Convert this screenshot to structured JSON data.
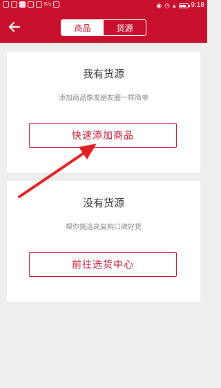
{
  "status_bar": {
    "carrier_text": "K/s",
    "time": "9:18",
    "icons": [
      "notification-icon",
      "notification-icon",
      "eye-icon",
      "alarm-icon",
      "signal-icon",
      "battery-icon"
    ]
  },
  "header": {
    "back_icon": "arrow-left-icon",
    "tabs": [
      {
        "label": "商品",
        "active": true
      },
      {
        "label": "货源",
        "active": false
      }
    ]
  },
  "cards": [
    {
      "title": "我有货源",
      "subtitle": "添加商品像发朋友圈一样简单",
      "button": "快速添加商品"
    },
    {
      "title": "没有货源",
      "subtitle": "帮你挑选高复购口碑好货",
      "button": "前往选货中心"
    }
  ],
  "colors": {
    "brand": "#c8102e",
    "background": "#eeeeee",
    "card": "#ffffff",
    "annotation": "#e02020"
  }
}
